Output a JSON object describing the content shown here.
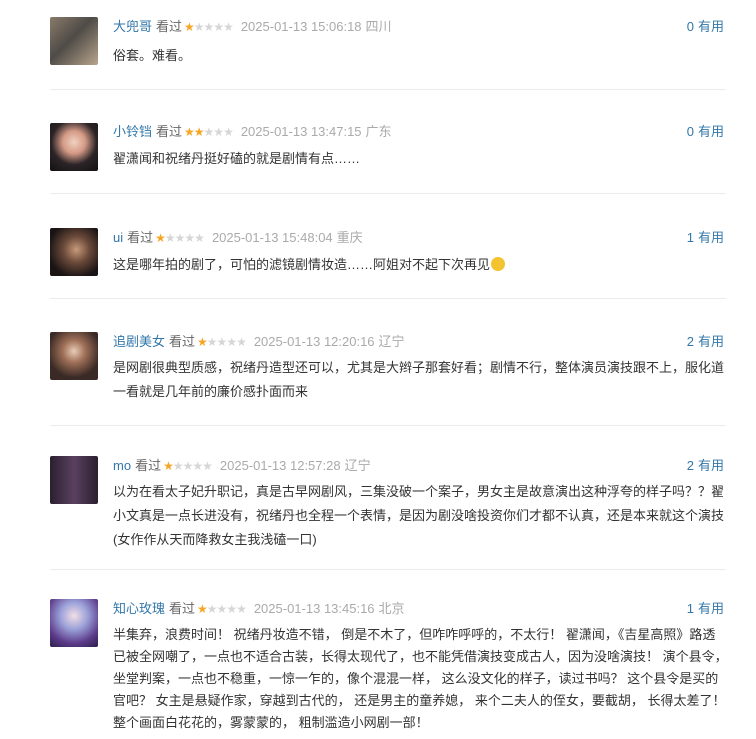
{
  "comments": [
    {
      "username": "大兜哥",
      "watched": "看过",
      "rating": 1,
      "time": "2025-01-13 15:06:18",
      "location": "四川",
      "useful_count": "0",
      "useful_label": "有用",
      "text": "俗套。难看。"
    },
    {
      "username": "小铃铛",
      "watched": "看过",
      "rating": 2,
      "time": "2025-01-13 13:47:15",
      "location": "广东",
      "useful_count": "0",
      "useful_label": "有用",
      "text": "翟潇闻和祝绪丹挺好磕的就是剧情有点……"
    },
    {
      "username": "ui",
      "watched": "看过",
      "rating": 1,
      "time": "2025-01-13 15:48:04",
      "location": "重庆",
      "useful_count": "1",
      "useful_label": "有用",
      "text": "这是哪年拍的剧了，可怕的滤镜剧情妆造……阿姐对不起下次再见"
    },
    {
      "username": "追剧美女",
      "watched": "看过",
      "rating": 1,
      "time": "2025-01-13 12:20:16",
      "location": "辽宁",
      "useful_count": "2",
      "useful_label": "有用",
      "text": "是网剧很典型质感，祝绪丹造型还可以，尤其是大辫子那套好看；剧情不行，整体演员演技跟不上，服化道一看就是几年前的廉价感扑面而来"
    },
    {
      "username": "mo",
      "watched": "看过",
      "rating": 1,
      "time": "2025-01-13 12:57:28",
      "location": "辽宁",
      "useful_count": "2",
      "useful_label": "有用",
      "text": "以为在看太子妃升职记，真是古早网剧风，三集没破一个案子，男女主是故意演出这种浮夸的样子吗？？翟小文真是一点长进没有，祝绪丹也全程一个表情，是因为剧没啥投资你们才都不认真，还是本来就这个演技(女作作从天而降救女主我浅磕一口)"
    },
    {
      "username": "知心玫瑰",
      "watched": "看过",
      "rating": 1,
      "time": "2025-01-13 13:45:16",
      "location": "北京",
      "useful_count": "1",
      "useful_label": "有用",
      "text": "半集弃，浪费时间！ 祝绪丹妆造不错，  倒是不木了，但咋咋呼呼的，不太行！ 翟潇闻，《吉星高照》路透已被全网嘲了，一点也不适合古装，长得太现代了，也不能凭借演技变成古人，因为没啥演技！ 演个县令，坐堂判案，一点也不稳重，一惊一乍的，像个混混一样，  这么没文化的样子，读过书吗？ 这个县令是买的官吧？ 女主是悬疑作家，穿越到古代的，  还是男主的童养媳，  来个二夫人的侄女，要截胡，  长得太差了！ 整个画面白花花的，雾蒙蒙的，  粗制滥造小网剧一部！"
    }
  ]
}
